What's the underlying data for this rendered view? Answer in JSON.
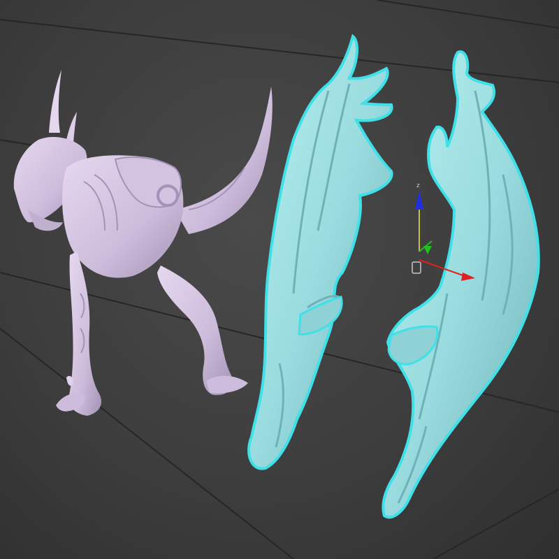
{
  "viewport": {
    "background_color": "#3d3d3d",
    "grid_line_color": "#262626"
  },
  "creature": {
    "name_icon": "dragon-body-mesh",
    "material_color": "#d8c8e4",
    "shadow_color": "#a898b8"
  },
  "wings": {
    "icon": "dragon-wing-mesh",
    "fill_color": "#9fe4e6",
    "selection_outline_color": "#3fe0e8",
    "shade_color": "#6fb8bc",
    "selected": true
  },
  "gizmo": {
    "icon": "transform-gizmo",
    "z_axis_label": "z",
    "z_color": "#2030e0",
    "x_color": "#e02020",
    "y_color": "#20c020",
    "pivot_icon": "pivot-box-icon"
  }
}
